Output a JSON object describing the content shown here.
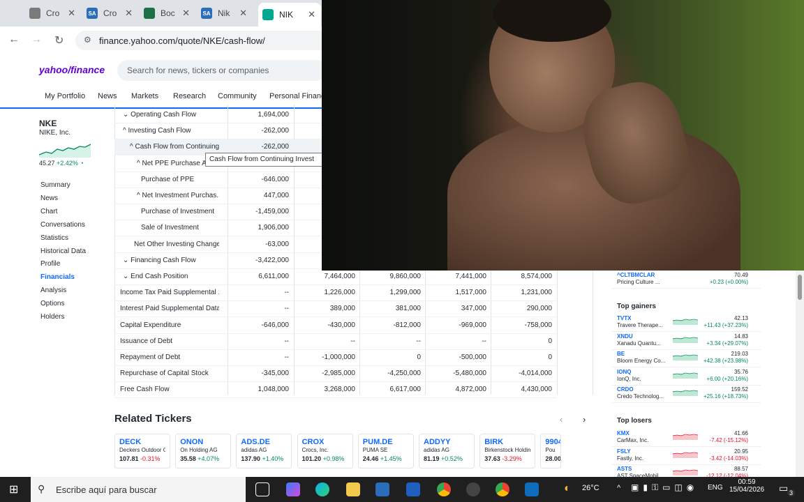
{
  "browser": {
    "tabs": [
      {
        "label": "Cro",
        "fav_color": "#7a7a7a",
        "fav_text": ""
      },
      {
        "label": "Cro",
        "fav_color": "#2a6ebb",
        "fav_text": "SA"
      },
      {
        "label": "Boc",
        "fav_color": "#1e7145",
        "fav_text": ""
      },
      {
        "label": "Nik",
        "fav_color": "#2a6ebb",
        "fav_text": "SA"
      },
      {
        "label": "NIK",
        "fav_color": "#00a88f",
        "fav_text": ""
      }
    ],
    "url": "finance.yahoo.com/quote/NKE/cash-flow/"
  },
  "yahoo": {
    "logo": "yahoo/finance",
    "search_placeholder": "Search for news, tickers or companies",
    "nav": [
      "My Portfolio",
      "News",
      "Markets",
      "Research",
      "Community",
      "Personal Finance"
    ]
  },
  "quote": {
    "symbol": "NKE",
    "name": "NIKE, Inc.",
    "price": "45.27",
    "change": "+2.42%"
  },
  "sidebar": [
    "Summary",
    "News",
    "Chart",
    "Conversations",
    "Statistics",
    "Historical Data",
    "Profile",
    "Financials",
    "Analysis",
    "Options",
    "Holders"
  ],
  "table": {
    "rows": [
      {
        "label": "Operating Cash Flow",
        "prefix": "⌄ ",
        "values": [
          "1,694,000",
          "",
          "",
          "",
          ""
        ]
      },
      {
        "label": "Investing Cash Flow",
        "prefix": "^ ",
        "values": [
          "-262,000",
          "",
          "",
          "",
          ""
        ]
      },
      {
        "label": "Cash Flow from Continuing...",
        "prefix": "^ ",
        "values": [
          "-262,000",
          "",
          "",
          "",
          ""
        ]
      },
      {
        "label": "Net PPE Purchase A",
        "prefix": "^ ",
        "values": [
          "",
          "",
          "",
          "",
          ""
        ]
      },
      {
        "label": "Purchase of PPE",
        "prefix": "",
        "values": [
          "-646,000",
          "",
          "",
          "",
          ""
        ]
      },
      {
        "label": "Net Investment Purchas...",
        "prefix": "^ ",
        "values": [
          "447,000",
          "",
          "",
          "",
          ""
        ]
      },
      {
        "label": "Purchase of Investment",
        "prefix": "",
        "values": [
          "-1,459,000",
          "",
          "",
          "",
          ""
        ]
      },
      {
        "label": "Sale of Investment",
        "prefix": "",
        "values": [
          "1,906,000",
          "",
          "",
          "",
          ""
        ]
      },
      {
        "label": "Net Other Investing Changes",
        "prefix": "",
        "values": [
          "-63,000",
          "",
          "",
          "",
          ""
        ]
      },
      {
        "label": "Financing Cash Flow",
        "prefix": "⌄ ",
        "values": [
          "-3,422,000",
          "",
          "",
          "",
          ""
        ]
      },
      {
        "label": "End Cash Position",
        "prefix": "⌄ ",
        "values": [
          "6,611,000",
          "7,464,000",
          "9,860,000",
          "7,441,000",
          "8,574,000"
        ]
      },
      {
        "label": "Income Tax Paid Supplemental ...",
        "prefix": "",
        "values": [
          "--",
          "1,226,000",
          "1,299,000",
          "1,517,000",
          "1,231,000"
        ]
      },
      {
        "label": "Interest Paid Supplemental Data",
        "prefix": "",
        "values": [
          "--",
          "389,000",
          "381,000",
          "347,000",
          "290,000"
        ]
      },
      {
        "label": "Capital Expenditure",
        "prefix": "",
        "values": [
          "-646,000",
          "-430,000",
          "-812,000",
          "-969,000",
          "-758,000"
        ]
      },
      {
        "label": "Issuance of Debt",
        "prefix": "",
        "values": [
          "--",
          "--",
          "--",
          "--",
          "0"
        ]
      },
      {
        "label": "Repayment of Debt",
        "prefix": "",
        "values": [
          "--",
          "-1,000,000",
          "0",
          "-500,000",
          "0"
        ]
      },
      {
        "label": "Repurchase of Capital Stock",
        "prefix": "",
        "values": [
          "-345,000",
          "-2,985,000",
          "-4,250,000",
          "-5,480,000",
          "-4,014,000"
        ]
      },
      {
        "label": "Free Cash Flow",
        "prefix": "",
        "values": [
          "1,048,000",
          "3,268,000",
          "6,617,000",
          "4,872,000",
          "4,430,000"
        ]
      }
    ],
    "tooltip": "Cash Flow from Continuing Invest"
  },
  "related": {
    "title": "Related Tickers",
    "cards": [
      {
        "sym": "DECK",
        "name": "Deckers Outdoor Corp...",
        "price": "107.81",
        "chg": "-0.31%",
        "dir": "dn"
      },
      {
        "sym": "ONON",
        "name": "On Holding AG",
        "price": "35.58",
        "chg": "+4.07%",
        "dir": "up"
      },
      {
        "sym": "ADS.DE",
        "name": "adidas AG",
        "price": "137.90",
        "chg": "+1.40%",
        "dir": "up"
      },
      {
        "sym": "CROX",
        "name": "Crocs, Inc.",
        "price": "101.20",
        "chg": "+0.98%",
        "dir": "up"
      },
      {
        "sym": "PUM.DE",
        "name": "PUMA SE",
        "price": "24.46",
        "chg": "+1.45%",
        "dir": "up"
      },
      {
        "sym": "ADDYY",
        "name": "adidas AG",
        "price": "81.19",
        "chg": "+0.52%",
        "dir": "up"
      },
      {
        "sym": "BIRK",
        "name": "Birkenstock Holding plc",
        "price": "37.63",
        "chg": "-3.29%",
        "dir": "dn"
      },
      {
        "sym": "9904",
        "name": "Pou Ch",
        "price": "28.00",
        "chg": "",
        "dir": "up"
      }
    ]
  },
  "rightpanel": {
    "top_item": {
      "sym": "^CLTBMCLAR",
      "name": "Pricing Culture ...",
      "price": "70.49",
      "chg": "+0.23 (+0.00%)"
    },
    "gainers_title": "Top gainers",
    "gainers": [
      {
        "sym": "TVTX",
        "name": "Travere Therape...",
        "price": "42.13",
        "chg": "+11.43 (+37.23%)"
      },
      {
        "sym": "XNDU",
        "name": "Xanadu Quantu...",
        "price": "14.83",
        "chg": "+3.34 (+29.07%)"
      },
      {
        "sym": "BE",
        "name": "Bloom Energy Co...",
        "price": "219.03",
        "chg": "+42.38 (+23.98%)"
      },
      {
        "sym": "IONQ",
        "name": "IonQ, Inc.",
        "price": "35.76",
        "chg": "+6.00 (+20.16%)"
      },
      {
        "sym": "CRDO",
        "name": "Credo Technolog...",
        "price": "159.52",
        "chg": "+25.16 (+18.73%)"
      }
    ],
    "losers_title": "Top losers",
    "losers": [
      {
        "sym": "KMX",
        "name": "CarMax, Inc.",
        "price": "41.66",
        "chg": "-7.42 (-15.12%)"
      },
      {
        "sym": "FSLY",
        "name": "Fastly, Inc.",
        "price": "20.95",
        "chg": "-3.42 (-14.03%)"
      },
      {
        "sym": "ASTS",
        "name": "AST SpaceMobil...",
        "price": "88.57",
        "chg": "-12.12 (-12.04%)"
      }
    ]
  },
  "taskbar": {
    "search": "Escribe aquí para buscar",
    "weather": "26°C",
    "lang": "ENG",
    "time": "00:59",
    "date": "15/04/2026",
    "notif": "3"
  }
}
